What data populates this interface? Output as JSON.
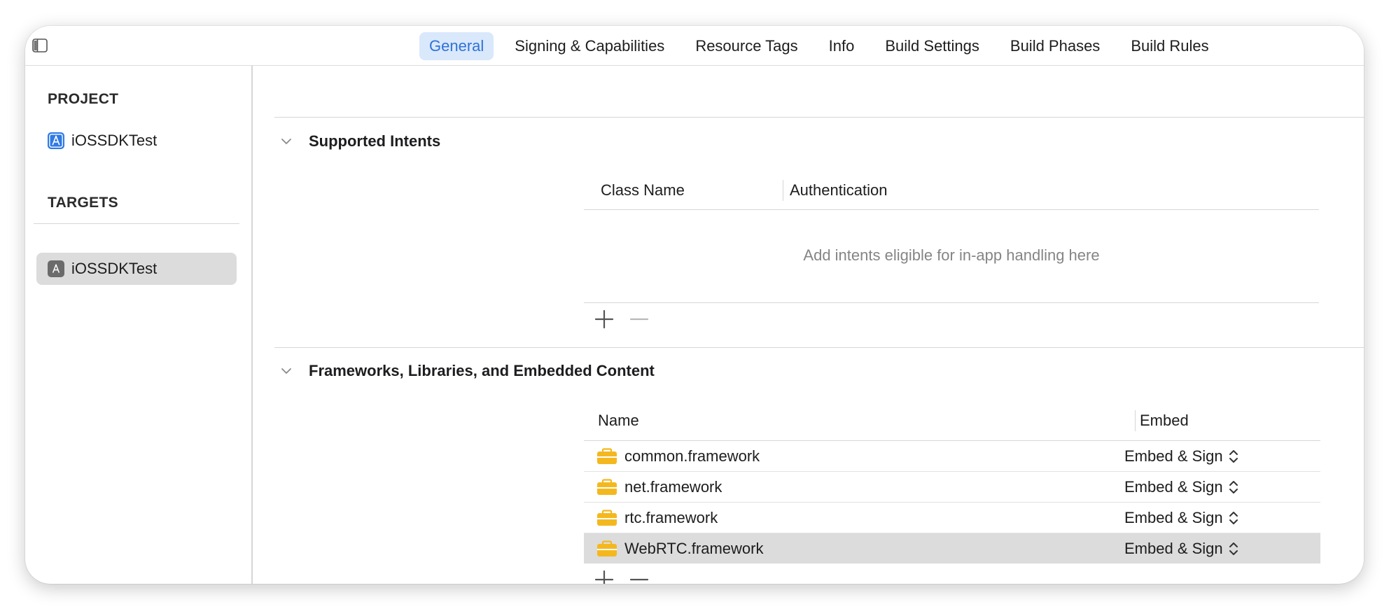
{
  "toolbar": {
    "sidebar_toggle_icon": "sidebar-toggle-icon",
    "tabs": [
      {
        "label": "General",
        "active": true
      },
      {
        "label": "Signing & Capabilities"
      },
      {
        "label": "Resource Tags"
      },
      {
        "label": "Info"
      },
      {
        "label": "Build Settings"
      },
      {
        "label": "Build Phases"
      },
      {
        "label": "Build Rules"
      }
    ]
  },
  "sidebar": {
    "project_heading": "PROJECT",
    "project_item": {
      "label": "iOSSDKTest",
      "icon": "xcode-project-icon"
    },
    "targets_heading": "TARGETS",
    "target_item": {
      "label": "iOSSDKTest",
      "icon": "app-target-icon",
      "selected": true
    }
  },
  "intents": {
    "title": "Supported Intents",
    "columns": [
      "Class Name",
      "Authentication"
    ],
    "empty_message": "Add intents eligible for in-app handling here"
  },
  "frameworks": {
    "title": "Frameworks, Libraries, and Embedded Content",
    "columns": [
      "Name",
      "Embed"
    ],
    "rows": [
      {
        "name": "common.framework",
        "embed": "Embed & Sign"
      },
      {
        "name": "net.framework",
        "embed": "Embed & Sign"
      },
      {
        "name": "rtc.framework",
        "embed": "Embed & Sign"
      },
      {
        "name": "WebRTC.framework",
        "embed": "Embed & Sign",
        "selected": true
      }
    ]
  },
  "colors": {
    "accent": "#2f72d6",
    "active_tab_bg": "#d9e8fb",
    "selection_bg": "#dcdcdc",
    "framework_icon": "#f4b81f"
  }
}
